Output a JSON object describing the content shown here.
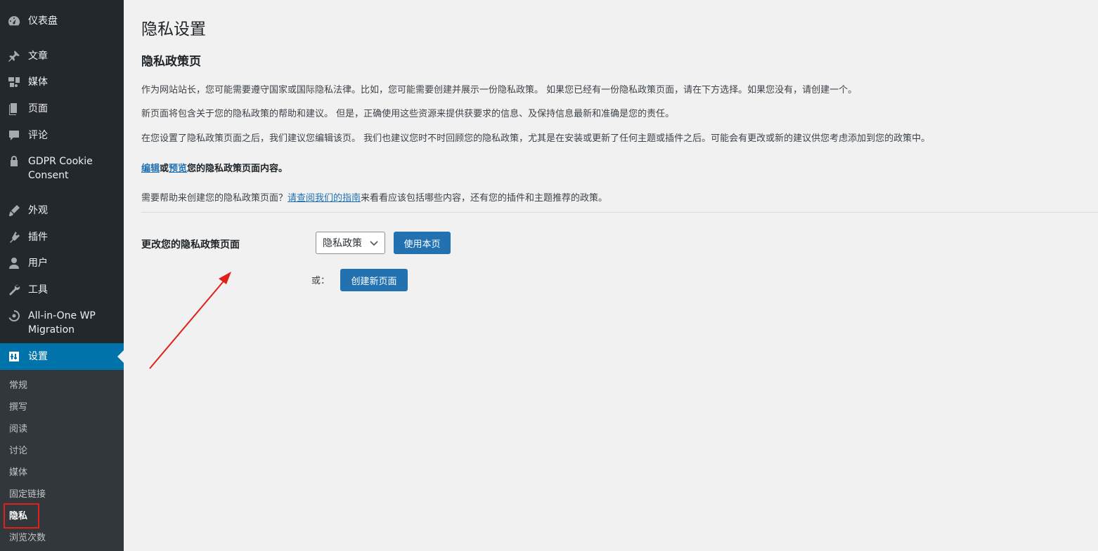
{
  "sidebar": {
    "items": [
      {
        "label": "仪表盘",
        "icon": "dashboard-icon"
      },
      {
        "label": "文章",
        "icon": "pin-icon"
      },
      {
        "label": "媒体",
        "icon": "media-icon"
      },
      {
        "label": "页面",
        "icon": "page-icon"
      },
      {
        "label": "评论",
        "icon": "comment-icon"
      },
      {
        "label": "GDPR Cookie Consent",
        "icon": "lock-icon"
      },
      {
        "label": "外观",
        "icon": "brush-icon"
      },
      {
        "label": "插件",
        "icon": "plugin-icon"
      },
      {
        "label": "用户",
        "icon": "user-icon"
      },
      {
        "label": "工具",
        "icon": "wrench-icon"
      },
      {
        "label": "All-in-One WP Migration",
        "icon": "migration-icon"
      },
      {
        "label": "设置",
        "icon": "settings-icon"
      }
    ],
    "submenu": [
      "常规",
      "撰写",
      "阅读",
      "讨论",
      "媒体",
      "固定链接",
      "隐私",
      "浏览次数"
    ]
  },
  "main": {
    "page_title": "隐私设置",
    "section_title": "隐私政策页",
    "para1": "作为网站站长，您可能需要遵守国家或国际隐私法律。比如，您可能需要创建并展示一份隐私政策。 如果您已经有一份隐私政策页面，请在下方选择。如果您没有，请创建一个。",
    "para2": "新页面将包含关于您的隐私政策的帮助和建议。 但是，正确使用这些资源来提供获要求的信息、及保持信息最新和准确是您的责任。",
    "para3": "在您设置了隐私政策页面之后，我们建议您编辑该页。 我们也建议您时不时回顾您的隐私政策，尤其是在安装或更新了任何主题或插件之后。可能会有更改或新的建议供您考虑添加到您的政策中。",
    "edit_link": "编辑",
    "edit_or": "或",
    "preview_link": "预览",
    "edit_suffix": "您的隐私政策页面内容。",
    "help_prefix": "需要帮助来创建您的隐私政策页面？",
    "help_link": "请查阅我们的指南",
    "help_suffix": "来看看应该包括哪些内容，还有您的插件和主题推荐的政策。",
    "form_label": "更改您的隐私政策页面",
    "select_value": "隐私政策",
    "use_button": "使用本页",
    "or_label": "或：",
    "create_button": "创建新页面"
  },
  "colors": {
    "sidebar_bg": "#23282d",
    "submenu_bg": "#32373c",
    "accent": "#0073aa",
    "button": "#2271b1",
    "annotation": "#e0201a"
  }
}
